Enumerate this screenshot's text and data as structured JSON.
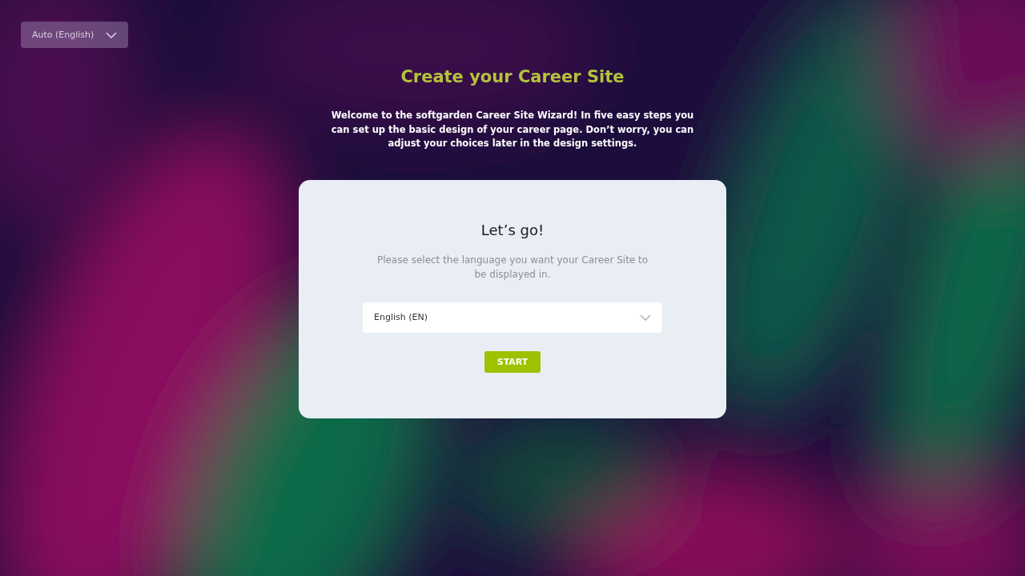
{
  "language_dropdown": {
    "value": "Auto (English)"
  },
  "title": "Create your Career Site",
  "intro": "Welcome to the softgarden Career Site Wizard! In five easy steps you can set up the basic design of your career page. Don’t worry, you can adjust your choices later in the design settings.",
  "card": {
    "heading": "Let’s go!",
    "description": "Please select the language you want your Career Site to be displayed in.",
    "select": {
      "value": "English (EN)"
    },
    "button": "START"
  }
}
